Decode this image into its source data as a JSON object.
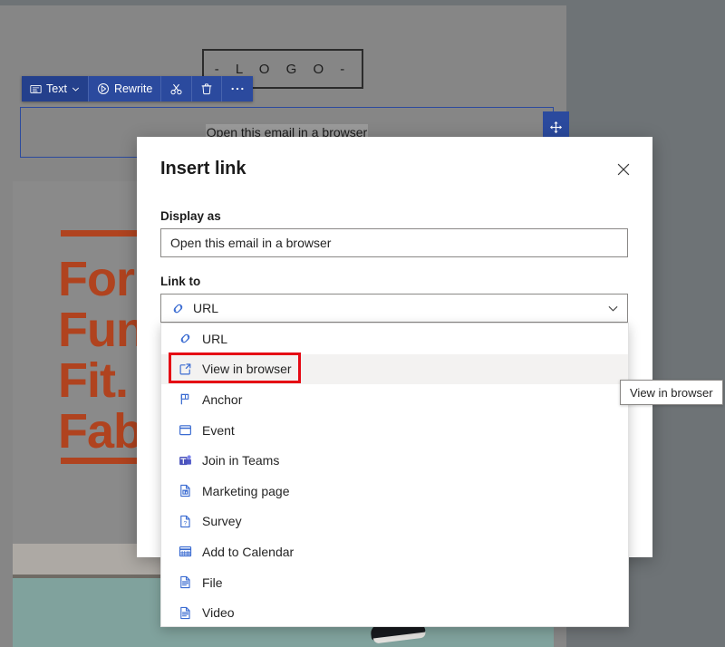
{
  "canvas": {
    "logo_placeholder": "-  L O G O  -",
    "browser_link_text": "Open this email in a browser",
    "hero_headline": "Form.\nFunction.\nFit.\nFabulous.",
    "hero_accent_color": "#b0431f",
    "selection_border_color": "#2b4a9e"
  },
  "toolbar": {
    "accent_color": "#2b4a9e",
    "items": [
      {
        "label": "Text",
        "icon": "text-style-icon",
        "chevron": true,
        "active": true
      },
      {
        "label": "Rewrite",
        "icon": "rewrite-sparkle-icon",
        "chevron": false,
        "active": false
      },
      {
        "label": "",
        "icon": "cut-icon",
        "chevron": false,
        "active": false
      },
      {
        "label": "",
        "icon": "trash-icon",
        "chevron": false,
        "active": false
      },
      {
        "label": "",
        "icon": "more-options-icon",
        "chevron": false,
        "active": false
      }
    ],
    "move_handle_icon": "move-arrows-icon"
  },
  "dialog": {
    "title": "Insert link",
    "close_icon": "close-icon",
    "display_as": {
      "label": "Display as",
      "value": "Open this email in a browser",
      "placeholder": "Display as"
    },
    "link_to": {
      "label": "Link to",
      "selected_value": "URL",
      "selected_icon": "url-link-icon",
      "chevron_icon": "chevron-down-icon"
    }
  },
  "dropdown": {
    "items": [
      {
        "label": "URL",
        "icon": "url-link-icon",
        "hover": false
      },
      {
        "label": "View in browser",
        "icon": "view-in-browser-icon",
        "hover": true
      },
      {
        "label": "Anchor",
        "icon": "anchor-flag-icon",
        "hover": false
      },
      {
        "label": "Event",
        "icon": "event-calendar-icon",
        "hover": false
      },
      {
        "label": "Join in Teams",
        "icon": "teams-icon",
        "hover": false
      },
      {
        "label": "Marketing page",
        "icon": "marketing-page-icon",
        "hover": false
      },
      {
        "label": "Survey",
        "icon": "survey-icon",
        "hover": false
      },
      {
        "label": "Add to Calendar",
        "icon": "add-to-calendar-icon",
        "hover": false
      },
      {
        "label": "File",
        "icon": "file-icon",
        "hover": false
      },
      {
        "label": "Video",
        "icon": "video-file-icon",
        "hover": false
      }
    ],
    "highlight_color": "#e50914",
    "highlighted_item": "View in browser"
  },
  "tooltip": {
    "text": "View in browser"
  }
}
